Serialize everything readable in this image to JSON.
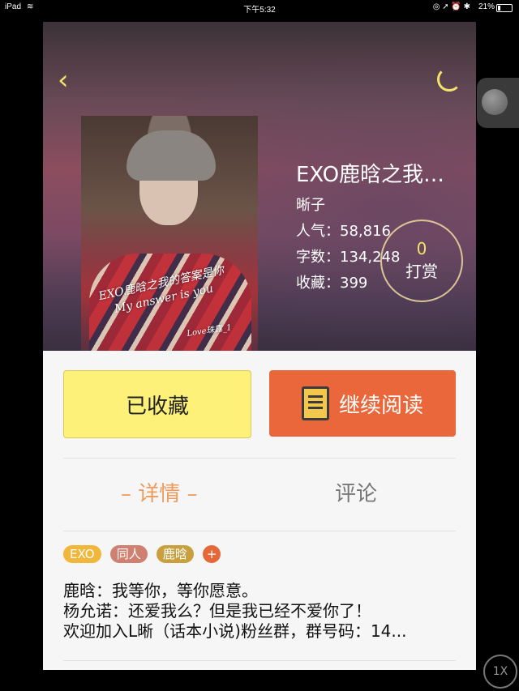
{
  "status_bar": {
    "device": "iPad",
    "time": "下午5:32",
    "indicators": "◎ ➚ ⏰ ✱",
    "battery": "21%",
    "battery_level": 0.21
  },
  "book": {
    "title": "EXO鹿晗之我…",
    "author": "晰子",
    "popularity_label": "人气：58,816",
    "word_count_label": "字数：134,248",
    "favorites_label": "收藏：399",
    "cover_text": [
      "EXO鹿晗之我的答案是你",
      "My answer is you",
      "Love珠露_1"
    ]
  },
  "reward": {
    "count": "0",
    "label": "打赏"
  },
  "actions": {
    "collected": "已收藏",
    "continue_reading": "继续阅读"
  },
  "tabs": {
    "details": "– 详情 –",
    "comments": "评论"
  },
  "tags": [
    "EXO",
    "同人",
    "鹿晗",
    "+"
  ],
  "description": [
    "鹿晗：我等你，等你愿意。",
    "杨允诺：还爱我么？但是我已经不爱你了！",
    "欢迎加入L晰（话本小说)粉丝群，群号码：14..."
  ],
  "zoom": "1X",
  "colors": {
    "accent_yellow": "#fdf17a",
    "accent_orange": "#e9673a",
    "tab_active": "#f09a5b"
  },
  "icons": {
    "back": "chevron-left",
    "loading": "spinner",
    "continue": "book"
  }
}
